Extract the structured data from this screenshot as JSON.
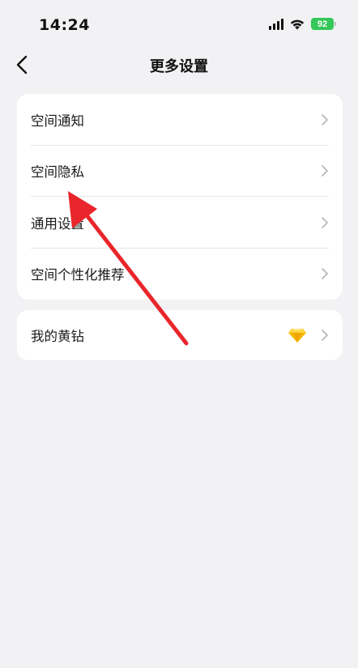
{
  "status_bar": {
    "time": "14:24",
    "battery": "92",
    "icons": [
      "signal-icon",
      "wifi-icon",
      "battery-icon"
    ]
  },
  "nav": {
    "title": "更多设置",
    "back_icon": "chevron-left-icon"
  },
  "settings": {
    "items": [
      {
        "label": "空间通知"
      },
      {
        "label": "空间隐私"
      },
      {
        "label": "通用设置"
      },
      {
        "label": "空间个性化推荐"
      }
    ]
  },
  "vip": {
    "label": "我的黄钻",
    "icon": "diamond-icon"
  },
  "colors": {
    "background": "#f2f2f4",
    "card": "#ffffff",
    "battery": "#34c759",
    "annotation_arrow": "#e8262b",
    "diamond": "#f5b800"
  }
}
